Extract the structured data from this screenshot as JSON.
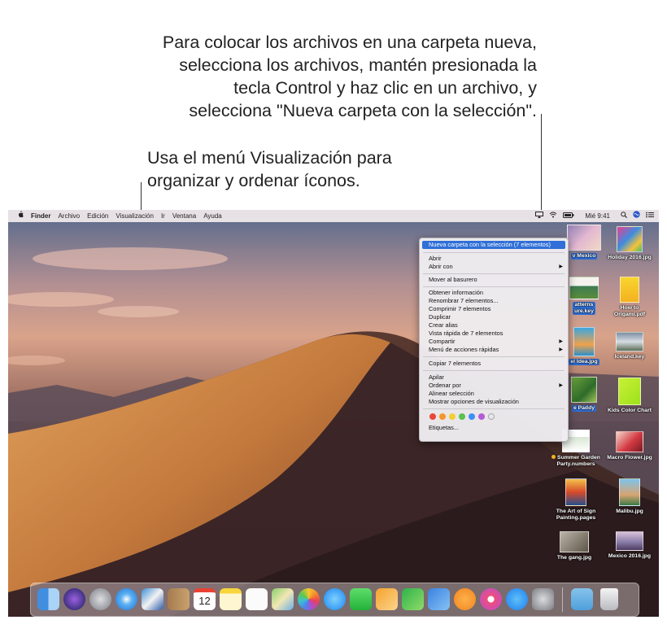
{
  "callouts": {
    "top": [
      "Para colocar los archivos en una carpeta nueva,",
      "selecciona los archivos, mantén presionada la",
      "tecla Control y haz clic en un archivo, y",
      "selecciona \"Nueva carpeta con la selección\"."
    ],
    "left": [
      "Usa el menú Visualización para",
      "organizar y ordenar íconos."
    ]
  },
  "menubar": {
    "apple": "",
    "items": [
      "Finder",
      "Archivo",
      "Edición",
      "Visualización",
      "Ir",
      "Ventana",
      "Ayuda"
    ],
    "clock": "Mié 9:41",
    "status_icons": [
      "airplay-icon",
      "wifi-icon",
      "battery-icon",
      "search-icon",
      "siri-icon",
      "notification-center-icon"
    ]
  },
  "context_menu": {
    "highlighted": "Nueva carpeta con la selección (7 elementos)",
    "group1": [
      "Abrir",
      "Abrir con"
    ],
    "group2": [
      "Mover al basurero"
    ],
    "group3": [
      "Obtener información",
      "Renombrar 7 elementos...",
      "Comprimir 7 elementos",
      "Duplicar",
      "Crear alias",
      "Vista rápida de 7 elementos",
      "Compartir",
      "Menú de acciones rápidas"
    ],
    "group4": [
      "Copiar 7 elementos"
    ],
    "group5": [
      "Apilar",
      "Ordenar por",
      "Alinear selección",
      "Mostrar opciones de visualización"
    ],
    "tags_label": "Etiquetas...",
    "tag_colors": [
      "#e8473b",
      "#f5962a",
      "#f4cf33",
      "#5ac24c",
      "#3e8ef7",
      "#b45bd6",
      "#a7a7ab"
    ]
  },
  "desktop": {
    "col1": [
      {
        "label": "v Mexico",
        "selected": true
      },
      {
        "label": "atterns\nure.key",
        "selected": true
      },
      {
        "label": "el Idea.jpg",
        "selected": true
      },
      {
        "label": "e Paddy",
        "selected": true
      },
      {
        "label": "Summer Garden\nParty.numbers",
        "selected": false
      },
      {
        "label": "The Art of Sign\nPainting.pages",
        "selected": false
      },
      {
        "label": "The gang.jpg",
        "selected": false
      }
    ],
    "col2": [
      {
        "label": "Holiday 2016.jpg"
      },
      {
        "label": "How to\nOrigami.pdf"
      },
      {
        "label": "Iceland.key"
      },
      {
        "label": "Kids Color Chart"
      },
      {
        "label": "Macro Flower.jpg"
      },
      {
        "label": "Malibu.jpg"
      },
      {
        "label": "Mexico 2016.jpg"
      }
    ]
  },
  "dock": {
    "apps": [
      "finder-icon",
      "siri-icon",
      "launchpad-icon",
      "safari-icon",
      "photo-browser-icon",
      "contacts-icon",
      "calendar-icon",
      "notes-icon",
      "reminders-icon",
      "maps-icon",
      "photos-icon",
      "messages-icon",
      "facetime-icon",
      "pages-icon",
      "numbers-icon",
      "keynote-icon",
      "books-icon",
      "music-icon",
      "app-store-icon",
      "system-preferences-icon",
      "downloads-folder-icon",
      "trash-icon"
    ],
    "calendar_day": "12"
  }
}
